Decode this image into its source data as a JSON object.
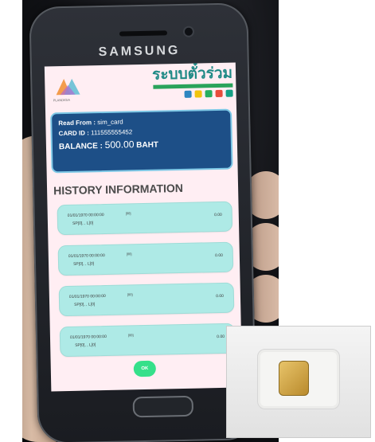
{
  "phone": {
    "brand": "SAMSUNG"
  },
  "app": {
    "logo_left_caption": "PLANDIGIA",
    "logo_right_title": "ระบบตั๋วร่วม"
  },
  "card": {
    "read_from_label": "Read From :",
    "read_from_value": "sim_card",
    "card_id_label": "CARD ID :",
    "card_id_value": "111555555452",
    "balance_label": "BALANCE :",
    "balance_value": "500.00",
    "balance_unit": "BAHT"
  },
  "history": {
    "title": "HISTORY INFORMATION",
    "items": [
      {
        "date": "01/01/1970 00:00:00",
        "code": "[00]",
        "sub": "SP[0], , L[0]",
        "amount": "0.00"
      },
      {
        "date": "01/01/1970 00:00:00",
        "code": "[00]",
        "sub": "SP[0], , L[0]",
        "amount": "0.00"
      },
      {
        "date": "01/01/1970 00:00:00",
        "code": "[00]",
        "sub": "SP[0], , L[0]",
        "amount": "0.00"
      },
      {
        "date": "01/01/1970 00:00:00",
        "code": "[00]",
        "sub": "SP[0], , L[0]",
        "amount": "0.00"
      }
    ]
  },
  "ok_button": {
    "label": "OK"
  },
  "colors": {
    "card_bg": "#1d4f87",
    "item_bg": "#aeeae6",
    "ok_green": "#35e08a",
    "screen_bg": "#ffeef3"
  }
}
